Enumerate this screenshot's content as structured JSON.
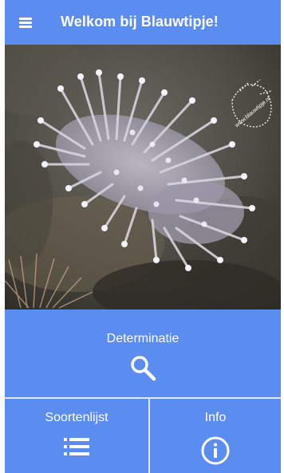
{
  "app_bar": {
    "title": "Welkom bij Blauwtipje!",
    "menu_icon": "hamburger-menu-icon"
  },
  "hero": {
    "watermark_text": "www.blauwtipje.nl"
  },
  "tiles": {
    "determination": {
      "label": "Determinatie",
      "icon": "search-icon"
    },
    "species_list": {
      "label": "Soortenlijst",
      "icon": "list-icon"
    },
    "info": {
      "label": "Info",
      "icon": "info-icon"
    }
  },
  "colors": {
    "primary": "#5b8cf0",
    "divider": "#dfe8fb",
    "text": "#ffffff"
  }
}
